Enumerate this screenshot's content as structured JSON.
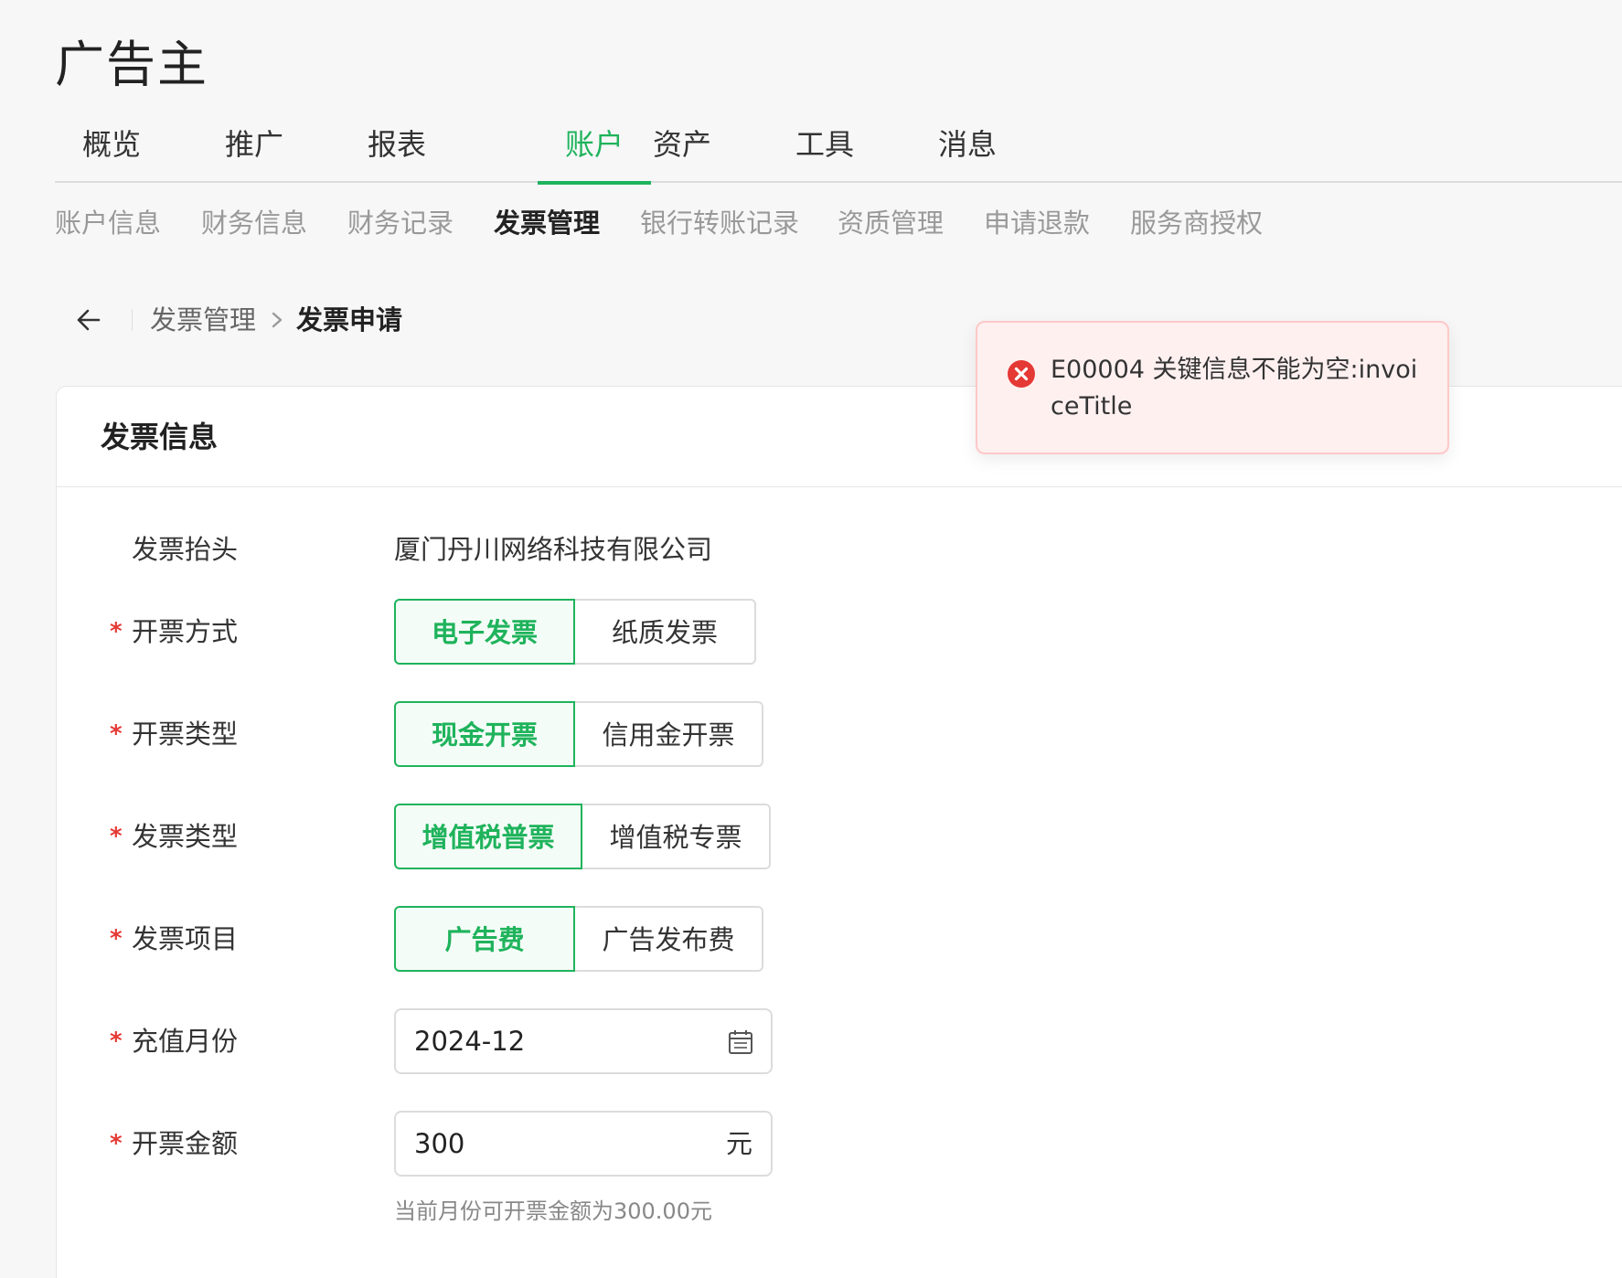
{
  "app": {
    "title": "广告主"
  },
  "top_nav": {
    "items": [
      {
        "label": "概览",
        "active": false
      },
      {
        "label": "推广",
        "active": false
      },
      {
        "label": "报表",
        "active": false
      },
      {
        "label": "账户",
        "active": true
      },
      {
        "label": "资产",
        "active": false
      },
      {
        "label": "工具",
        "active": false
      },
      {
        "label": "消息",
        "active": false
      }
    ]
  },
  "sub_nav": {
    "items": [
      {
        "label": "账户信息",
        "active": false
      },
      {
        "label": "财务信息",
        "active": false
      },
      {
        "label": "财务记录",
        "active": false
      },
      {
        "label": "发票管理",
        "active": true
      },
      {
        "label": "银行转账记录",
        "active": false
      },
      {
        "label": "资质管理",
        "active": false
      },
      {
        "label": "申请退款",
        "active": false
      },
      {
        "label": "服务商授权",
        "active": false
      }
    ]
  },
  "breadcrumb": {
    "parent": "发票管理",
    "current": "发票申请"
  },
  "card": {
    "title": "发票信息",
    "invoice_title": {
      "label": "发票抬头",
      "value": "厦门丹川网络科技有限公司"
    },
    "issue_method": {
      "label": "开票方式",
      "required_mark": "*",
      "options": [
        "电子发票",
        "纸质发票"
      ],
      "selected": "电子发票"
    },
    "issue_type": {
      "label": "开票类型",
      "required_mark": "*",
      "options": [
        "现金开票",
        "信用金开票"
      ],
      "selected": "现金开票"
    },
    "invoice_type": {
      "label": "发票类型",
      "required_mark": "*",
      "options": [
        "增值税普票",
        "增值税专票"
      ],
      "selected": "增值税普票"
    },
    "invoice_item": {
      "label": "发票项目",
      "required_mark": "*",
      "options": [
        "广告费",
        "广告发布费"
      ],
      "selected": "广告费"
    },
    "recharge_month": {
      "label": "充值月份",
      "required_mark": "*",
      "value": "2024-12",
      "icon": "calendar-icon"
    },
    "invoice_amount": {
      "label": "开票金额",
      "required_mark": "*",
      "value": "300",
      "suffix": "元",
      "hint": "当前月份可开票金额为300.00元"
    }
  },
  "toast": {
    "type": "error",
    "icon": "error-circle-icon",
    "message": "E00004 关键信息不能为空:invoiceTitle"
  },
  "colors": {
    "accent": "#1fb35c",
    "error": "#e53935",
    "toast_bg": "#fff0f0",
    "page_bg": "#f7f7f7"
  }
}
